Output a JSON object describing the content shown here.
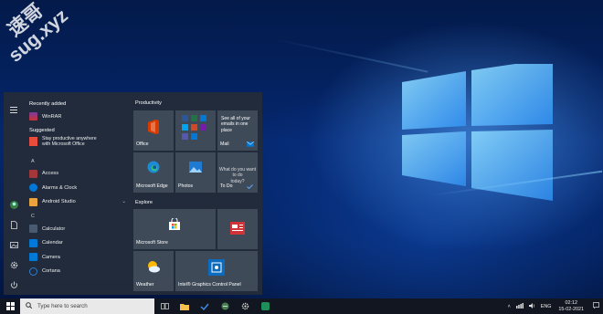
{
  "watermark": {
    "line1": "速哥",
    "line2": "sug.xyz"
  },
  "start_menu": {
    "recently_added_label": "Recently added",
    "recent_app": "WinRAR",
    "suggested_label": "Suggested",
    "suggestion": {
      "line1": "Stay productive anywhere",
      "line2": "with Microsoft Office"
    },
    "letters": {
      "hash": "#",
      "a": "A",
      "c": "C"
    },
    "apps": [
      {
        "label": "Access",
        "color": "#a4373a"
      },
      {
        "label": "Alarms & Clock",
        "color": "#0078d7"
      },
      {
        "label": "Android Studio",
        "color": "#e8a33c",
        "chevron": "⌄"
      },
      {
        "label": "Calculator",
        "color": "#4a5a70"
      },
      {
        "label": "Calendar",
        "color": "#0078d7"
      },
      {
        "label": "Camera",
        "color": "#0078d7"
      },
      {
        "label": "Cortana",
        "color": "#2d7dd2"
      }
    ],
    "groups": {
      "productivity": "Productivity",
      "explore": "Explore"
    },
    "tiles": {
      "office": "Office",
      "mail_text": [
        "See all of your",
        "emails in one",
        "place"
      ],
      "mail": "Mail",
      "edge": "Microsoft Edge",
      "photos": "Photos",
      "todo_text": [
        "What do you want",
        "to do",
        "today?"
      ],
      "todo": "To Do",
      "store": "Microsoft Store",
      "weather": "Weather",
      "intel": "Intel® Graphics Control Panel"
    }
  },
  "taskbar": {
    "search_placeholder": "Type here to search",
    "lang": "ENG",
    "time": "02:12",
    "date": "15-02-2021"
  }
}
